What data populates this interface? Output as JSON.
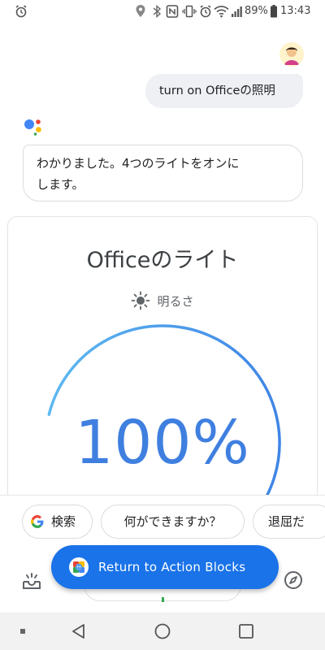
{
  "status_bar": {
    "battery_percent": "89%",
    "clock": "13:43",
    "icons": [
      "alarm-icon",
      "location-icon",
      "bluetooth-icon",
      "nfc-icon",
      "vibrate-icon",
      "alarm-icon",
      "wifi-icon",
      "signal-icon",
      "battery-icon"
    ]
  },
  "chat": {
    "user_message": "turn on Officeの照明",
    "assistant_message_line1": "わかりました。4つのライトをオンに",
    "assistant_message_line2": "します。"
  },
  "light_card": {
    "title": "Officeのライト",
    "brightness_label": "明るさ",
    "brightness_value": "100%",
    "brightness_fraction": 1.0,
    "accent_color": "#4a8fea"
  },
  "suggestions": {
    "search_label": "検索",
    "what_can_you_do_label": "何ができますか？",
    "bored_label": "退屈だ"
  },
  "action_blocks": {
    "button_label": "Return to Action Blocks",
    "color": "#1a73e8"
  },
  "nav_bar": {
    "icons": [
      "recents-dot-icon",
      "back-icon",
      "home-icon",
      "overview-icon"
    ]
  }
}
